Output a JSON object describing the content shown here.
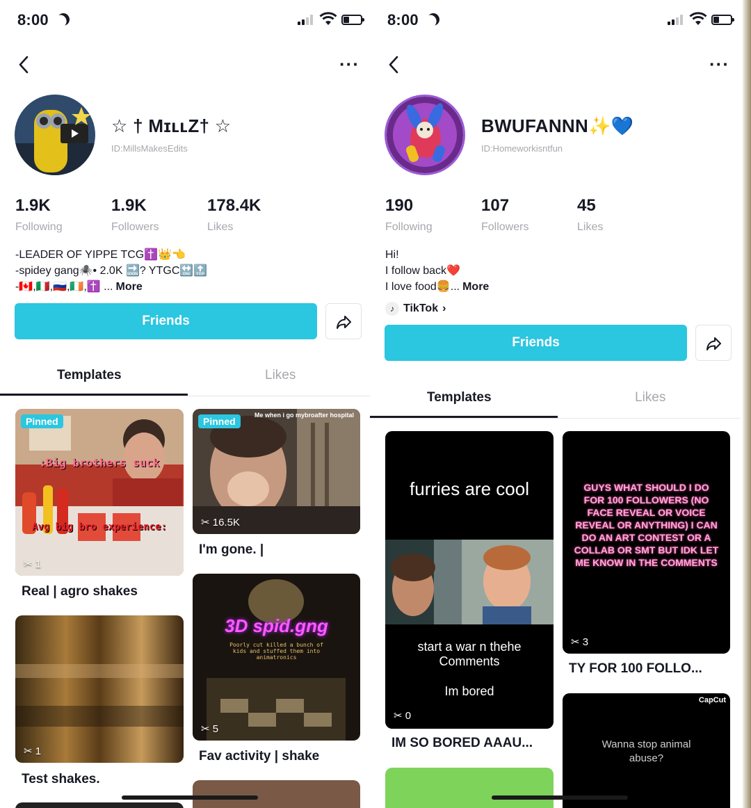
{
  "left": {
    "status": {
      "time": "8:00"
    },
    "profile": {
      "name": "☆ † MɪʟʟZ† ☆",
      "id": "ID:MillsMakesEdits",
      "stats": [
        {
          "value": "1.9K",
          "label": "Following"
        },
        {
          "value": "1.9K",
          "label": "Followers"
        },
        {
          "value": "178.4K",
          "label": "Likes"
        }
      ],
      "bio": [
        "-LEADER OF YIPPE TCG✝️👑👈",
        "-spidey gang🕷️• 2.0K 🔜? YTGC🔛🔝",
        "-🇨🇦,🇮🇹,🇷🇺,🇮🇪,✝️ ..."
      ],
      "bio_more": "More",
      "friends_label": "Friends"
    },
    "tabs": {
      "templates": "Templates",
      "likes": "Likes"
    },
    "cards": [
      {
        "pinned": "Pinned",
        "uses": "1",
        "caption": "Real | agro shakes",
        "overlay1": ":Big brothers suck",
        "overlay2": "Avg big bro experience:"
      },
      {
        "pinned": "Pinned",
        "uses": "16.5K",
        "caption": "I'm gone. |",
        "overlay1": "Me when i go mybroafter hospital"
      },
      {
        "uses": "1",
        "caption": "Test shakes."
      },
      {
        "uses": "5",
        "caption": "Fav activity | shake",
        "overlay1": "3D spid.gng",
        "overlay2": "Poorly cut killed a bunch of kids and stuffed them into animatronics"
      }
    ]
  },
  "right": {
    "status": {
      "time": "8:00"
    },
    "profile": {
      "name": "BWUFANNN✨💙",
      "id": "ID:Homeworkisntfun",
      "stats": [
        {
          "value": "190",
          "label": "Following"
        },
        {
          "value": "107",
          "label": "Followers"
        },
        {
          "value": "45",
          "label": "Likes"
        }
      ],
      "bio": [
        "Hi!",
        "I follow back❤️",
        "I love food🍔..."
      ],
      "bio_more": "More",
      "tiktok_link": "TikTok",
      "friends_label": "Friends"
    },
    "tabs": {
      "templates": "Templates",
      "likes": "Likes"
    },
    "cards": [
      {
        "uses": "0",
        "caption": "IM SO BORED AAAU...",
        "overlay1": "furries are cool",
        "overlay2": "start a war  n thehe Comments",
        "overlay3": "Im bored"
      },
      {
        "uses": "3",
        "caption": "TY FOR 100 FOLLO...",
        "overlay1": "Guys what should I do for 100 followers (no face reveal or voice reveal or anything) I can do an art contest or a collab or smt but idk let me know in the comments"
      },
      {
        "overlay1": "Wanna stop animal abuse?",
        "brand": "CapCut"
      }
    ]
  },
  "colors": {
    "accent": "#2bc6e0",
    "text": "#161823",
    "muted": "#a7a8ad"
  }
}
